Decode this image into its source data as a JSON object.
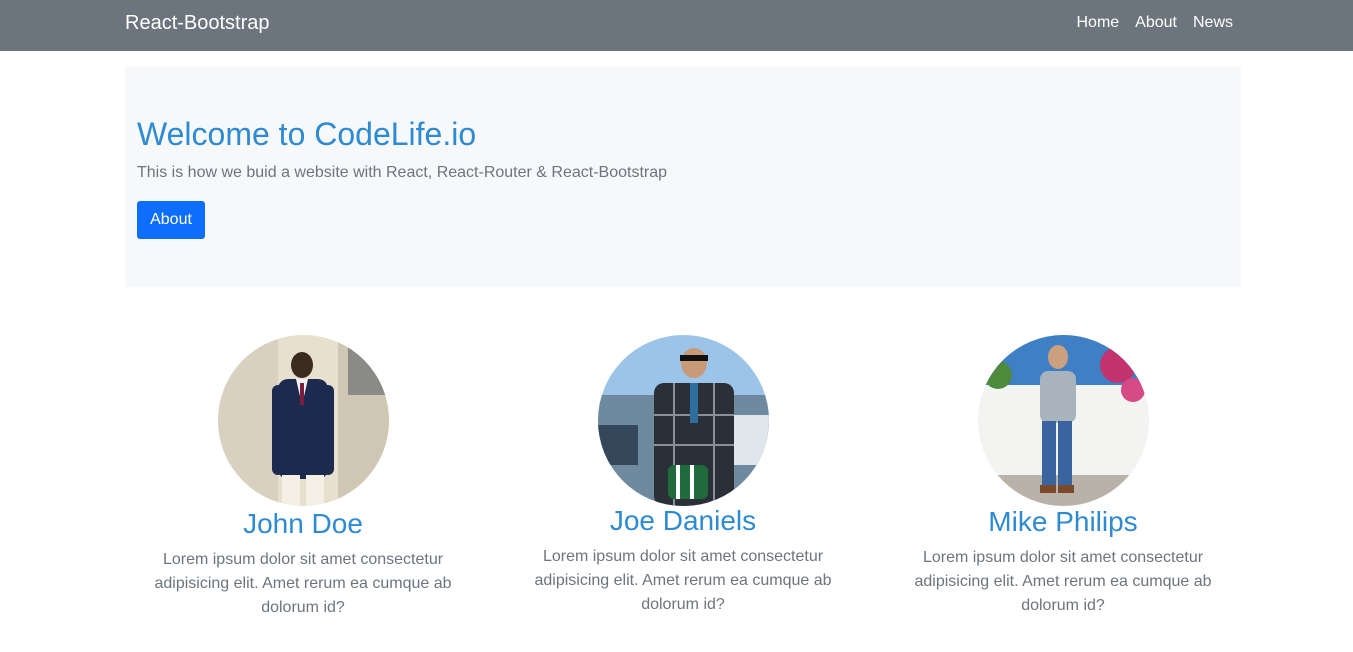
{
  "navbar": {
    "brand": "React-Bootstrap",
    "links": [
      "Home",
      "About",
      "News"
    ]
  },
  "jumbotron": {
    "title": "Welcome to CodeLife.io",
    "subtitle": "This is how we buid a website with React, React-Router & React-Bootstrap",
    "button_label": "About"
  },
  "people": [
    {
      "name": "John Doe",
      "bio": "Lorem ipsum dolor sit amet consectetur adipisicing elit. Amet rerum ea cumque ab dolorum id?"
    },
    {
      "name": "Joe Daniels",
      "bio": "Lorem ipsum dolor sit amet consectetur adipisicing elit. Amet rerum ea cumque ab dolorum id?"
    },
    {
      "name": "Mike Philips",
      "bio": "Lorem ipsum dolor sit amet consectetur adipisicing elit. Amet rerum ea cumque ab dolorum id?"
    }
  ],
  "colors": {
    "navbar_bg": "#6c757d",
    "jumbotron_bg": "#f7f8fa",
    "accent": "#2e8ad1",
    "button": "#0d6efd",
    "muted_text": "#6c757d"
  }
}
